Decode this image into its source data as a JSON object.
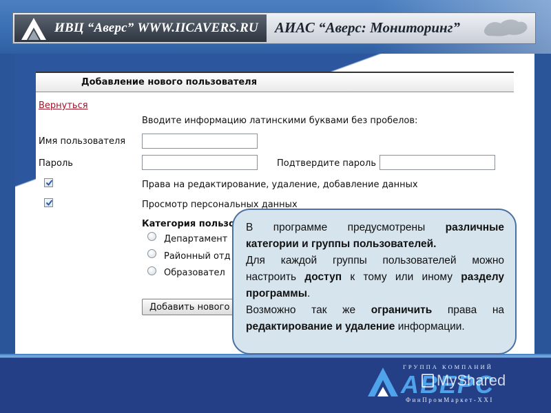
{
  "banner": {
    "left_text": "ИВЦ “Аверс” WWW.IICAVERS.RU",
    "right_text": "АИАС “Аверс: Мониторинг”"
  },
  "form": {
    "title": "Добавление нового пользователя",
    "back_link": "Вернуться",
    "hint": "Вводите информацию латинскими буквами без пробелов:",
    "username_label": "Имя пользователя",
    "username_value": "",
    "password_label": "Пароль",
    "password_value": "",
    "confirm_label": "Подтвердите пароль",
    "confirm_value": "",
    "perm_edit_label": "Права на редактирование, удаление, добавление данных",
    "perm_edit_checked": true,
    "perm_view_label": "Просмотр персональных данных",
    "perm_view_checked": true,
    "category_label": "Категория пользо",
    "category_options": [
      "Департамент",
      "Районный отд",
      "Образовател"
    ],
    "add_button": "Добавить нового"
  },
  "callout": {
    "p1_a": "В программе предусмотрены ",
    "p1_b": "различные категории и группы пользователей.",
    "p2_a": "Для каждой группы пользователей можно настроить ",
    "p2_b": "доступ",
    "p2_c": " к тому или иному ",
    "p2_d": "разделу программы",
    "p2_e": ".",
    "p3_a": "Возможно так же ",
    "p3_b": "ограничить",
    "p3_c": " права на ",
    "p3_d": "редактирование и удаление",
    "p3_e": " информации."
  },
  "footer": {
    "tagline": "ГРУППА КОМПАНИЙ",
    "brand": "АВЕРС",
    "sub": "ФинПромМаркет-XXI",
    "watermark": "MyShared"
  },
  "colors": {
    "slide_blue": "#2c579f",
    "callout_bg": "#d6e4ee",
    "link_red": "#a0142a",
    "logo_blue": "#4fa3ea"
  },
  "icons": [
    "avers-logo-icon",
    "russia-map-icon",
    "checkbox-checked-icon",
    "radio-icon"
  ]
}
